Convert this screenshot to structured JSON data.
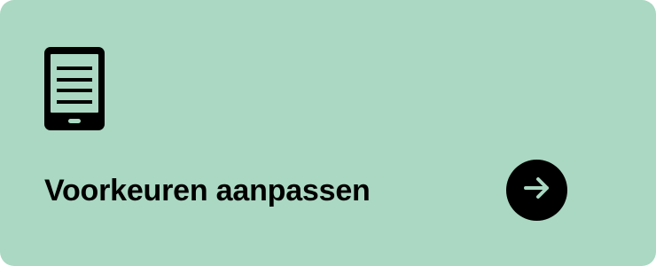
{
  "card": {
    "title": "Voorkeuren aanpassen",
    "icon": "tablet-icon",
    "action_icon": "arrow-right-icon",
    "background_color": "#aad8c2",
    "foreground_color": "#000000",
    "icon_line_color": "#aad8c2"
  }
}
